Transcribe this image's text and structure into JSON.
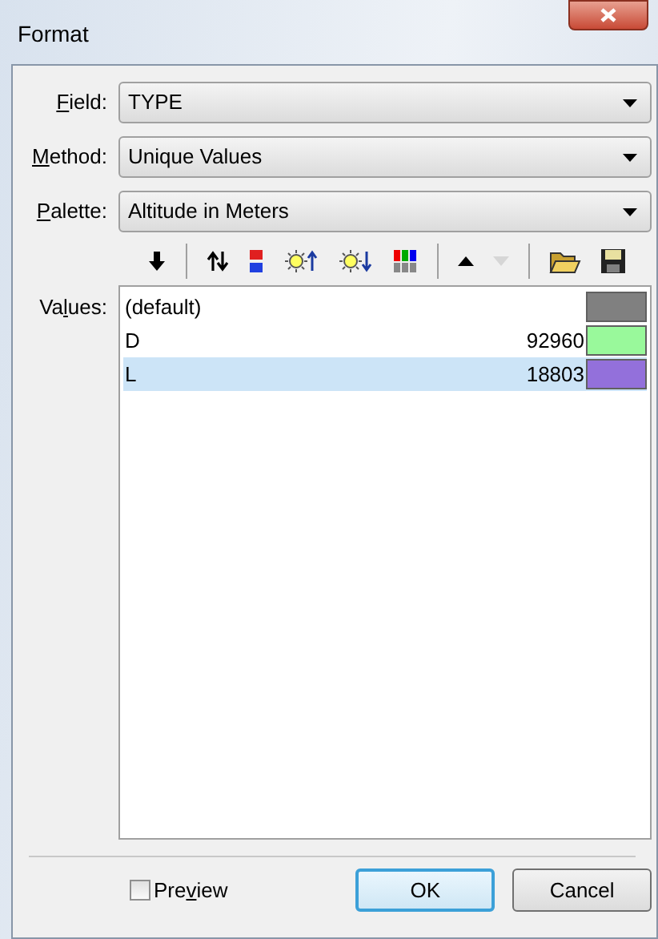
{
  "window": {
    "title": "Format"
  },
  "fields": [
    {
      "label": {
        "key": "F",
        "after": "ield:"
      },
      "value": "TYPE"
    },
    {
      "label": {
        "key": "M",
        "after": "ethod:"
      },
      "value": "Unique Values"
    },
    {
      "label": {
        "key": "P",
        "after": "alette:"
      },
      "value": "Altitude in Meters"
    }
  ],
  "toolbar": [
    {
      "kind": "down-arrow",
      "disabled": false
    },
    {
      "kind": "separator"
    },
    {
      "kind": "swap",
      "disabled": false
    },
    {
      "kind": "palette",
      "disabled": false
    },
    {
      "kind": "brighten",
      "disabled": false
    },
    {
      "kind": "darken",
      "disabled": false
    },
    {
      "kind": "bars",
      "disabled": false
    },
    {
      "kind": "separator"
    },
    {
      "kind": "up",
      "disabled": false
    },
    {
      "kind": "down",
      "disabled": true
    },
    {
      "kind": "separator"
    },
    {
      "kind": "open",
      "disabled": false
    },
    {
      "kind": "save",
      "disabled": false
    }
  ],
  "values": {
    "label": {
      "before": "Va",
      "key": "l",
      "after": "ues:"
    },
    "rows": [
      {
        "name": "(default)",
        "color": "#808080",
        "selected": false
      },
      {
        "name": "D",
        "count": "92960",
        "color": "#99f99b",
        "selected": false
      },
      {
        "name": "L",
        "count": "18803",
        "color": "#9370db",
        "selected": true
      }
    ]
  },
  "preview": {
    "label": {
      "before": "Pre",
      "key": "v",
      "after": "iew"
    },
    "checked": false
  },
  "buttons": [
    {
      "label": "OK",
      "default": true
    },
    {
      "label": "Cancel",
      "default": false
    }
  ]
}
